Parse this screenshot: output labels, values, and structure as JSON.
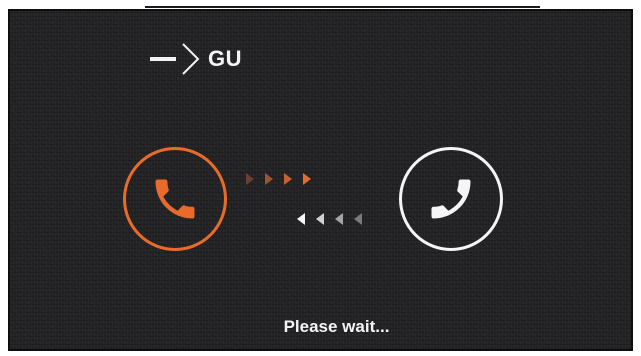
{
  "call": {
    "destination": "GU",
    "status": "Please wait..."
  },
  "icons": {
    "caller": "phone-handset-icon",
    "callee": "phone-handset-icon",
    "direction_marker": "chevron-right-icon",
    "outgoing_arrows": "triangle-right-icon",
    "incoming_arrows": "triangle-left-icon"
  },
  "colors": {
    "background": "#232325",
    "caller_accent": "#e86b2c",
    "callee_accent": "#f5f5f5",
    "text": "#f4f4f4",
    "arrow_faded_orange": "#6b4030",
    "arrow_faded_white": "#7a7a7a"
  }
}
